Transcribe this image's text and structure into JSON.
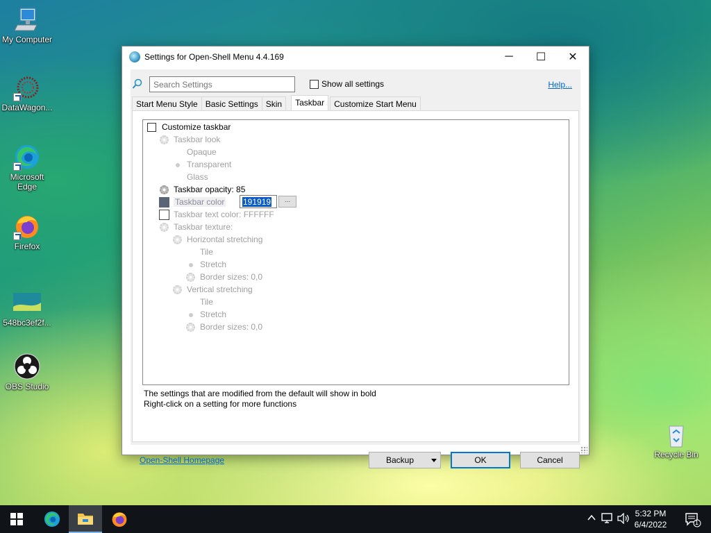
{
  "desktop": {
    "icons": [
      {
        "label": "My Computer",
        "icon": "computer-icon"
      },
      {
        "label": "DataWagon...",
        "icon": "datawagon-icon"
      },
      {
        "label": "Microsoft Edge",
        "icon": "edge-icon"
      },
      {
        "label": "Firefox",
        "icon": "firefox-icon"
      },
      {
        "label": "548bc3ef2f...",
        "icon": "image-file-icon"
      },
      {
        "label": "OBS Studio",
        "icon": "obs-icon"
      },
      {
        "label": "Recycle Bin",
        "icon": "recycle-bin-icon"
      }
    ]
  },
  "dialog": {
    "title": "Settings for Open-Shell Menu 4.4.169",
    "controls": {
      "minimize": "─",
      "maximize": "☐",
      "close": "✕"
    },
    "search_placeholder": "Search Settings",
    "show_all_label": "Show all settings",
    "help_link": "Help...",
    "tabs": [
      "Start Menu Style",
      "Basic Settings",
      "Skin",
      "Taskbar",
      "Customize Start Menu"
    ],
    "active_tab": "Taskbar",
    "tree": {
      "customize_taskbar": "Customize taskbar",
      "taskbar_look": "Taskbar look",
      "opaque": "Opaque",
      "transparent": "Transparent",
      "glass": "Glass",
      "taskbar_opacity": "Taskbar opacity: 85",
      "taskbar_color_label": "Taskbar color",
      "taskbar_color_value": "191919",
      "dots_button": "...",
      "taskbar_text_color": "Taskbar text color: FFFFFF",
      "taskbar_texture": "Taskbar texture:",
      "horizontal_stretching": "Horizontal stretching",
      "h_tile": "Tile",
      "h_stretch": "Stretch",
      "h_border_sizes": "Border sizes: 0,0",
      "vertical_stretching": "Vertical stretching",
      "v_tile": "Tile",
      "v_stretch": "Stretch",
      "v_border_sizes": "Border sizes: 0,0"
    },
    "note_line1": "The settings that are modified from the default will show in bold",
    "note_line2": "Right-click on a setting for more functions",
    "homepage_link": "Open-Shell Homepage",
    "backup_button": "Backup",
    "ok_button": "OK",
    "cancel_button": "Cancel"
  },
  "taskbar": {
    "time": "5:32 PM",
    "date": "6/4/2022",
    "notification_count": "1"
  },
  "colors": {
    "accent": "#0078d7",
    "taskbar_color_swatch": "#5a6675",
    "taskbar_bg": "#101418"
  }
}
